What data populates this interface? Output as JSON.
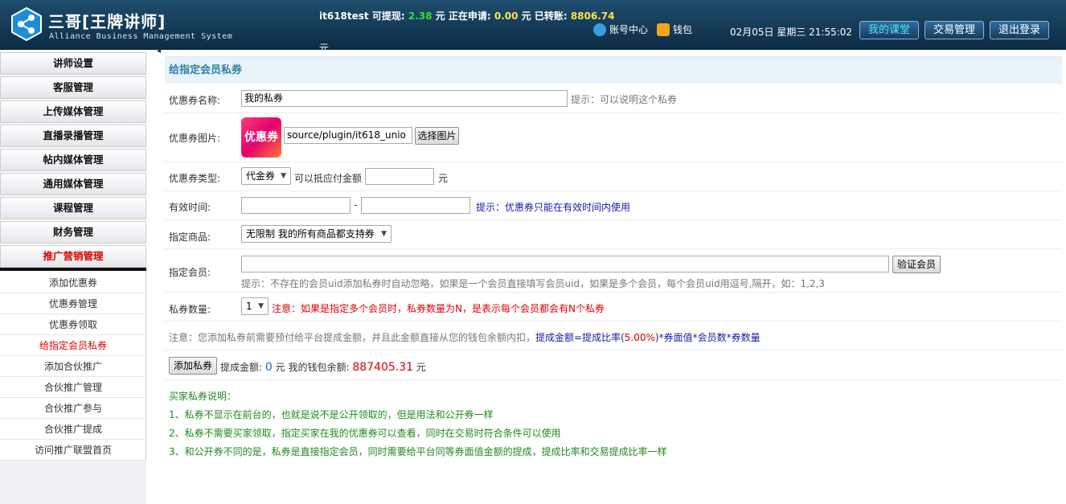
{
  "header": {
    "app_title": "三哥[王牌讲师]",
    "app_subtitle": "Alliance Business Management System",
    "balance": {
      "user": "it618test",
      "withdrawable_label": "可提现:",
      "withdrawable": "2.38",
      "unit": "元",
      "applying_label": "正在申请:",
      "applying": "0.00",
      "transferred_label": "元 已转账:",
      "transferred": "8806.74",
      "unit2": "元"
    },
    "links": {
      "account": "账号中心",
      "wallet": "钱包"
    },
    "datetime": "02月05日 星期三 21:55:02",
    "buttons": {
      "my_classroom": "我的课堂",
      "trade": "交易管理",
      "logout": "退出登录"
    }
  },
  "sidebar": {
    "items": [
      {
        "label": "讲师设置"
      },
      {
        "label": "客服管理"
      },
      {
        "label": "上传媒体管理"
      },
      {
        "label": "直播录播管理"
      },
      {
        "label": "帖内媒体管理"
      },
      {
        "label": "通用媒体管理"
      },
      {
        "label": "课程管理"
      },
      {
        "label": "财务管理"
      },
      {
        "label": "推广营销管理"
      }
    ],
    "sub_items": [
      {
        "label": "添加优惠券"
      },
      {
        "label": "优惠券管理"
      },
      {
        "label": "优惠券领取"
      },
      {
        "label": "给指定会员私券"
      },
      {
        "label": "添加合伙推广"
      },
      {
        "label": "合伙推广管理"
      },
      {
        "label": "合伙推广参与"
      },
      {
        "label": "合伙推广提成"
      },
      {
        "label": "访问推广联盟首页"
      }
    ]
  },
  "form": {
    "title": "给指定会员私券",
    "name": {
      "label": "优惠券名称:",
      "value": "我的私券",
      "hint": "提示：可以说明这个私券"
    },
    "image": {
      "label": "优惠券图片:",
      "badge_text": "优惠券",
      "path": "source/plugin/it618_unio",
      "button": "选择图片"
    },
    "type": {
      "label": "优惠券类型:",
      "selected": "代金券",
      "desc": "可以抵应付金额",
      "value": "",
      "unit": "元"
    },
    "valid_time": {
      "label": "有效时间:",
      "start": "",
      "dash": "-",
      "end": "",
      "hint": "提示：优惠券只能在有效时间内使用"
    },
    "goods": {
      "label": "指定商品:",
      "selected": "无限制 我的所有商品都支持券"
    },
    "members": {
      "label": "指定会员:",
      "value": "",
      "button": "验证会员",
      "hint": "提示：不存在的会员uid添加私券时自动忽略，如果是一个会员直接填写会员uid，如果是多个会员，每个会员uid用逗号,隔开，如：1,2,3"
    },
    "quantity": {
      "label": "私券数量:",
      "selected": "1",
      "note": "注意：如果是指定多个会员时，私券数量为N，是表示每个会员都会有N个私券"
    },
    "notice": {
      "prefix": "注意：您添加私券前需要预付给平台提成金额，并且此金额直接从您的钱包余额内扣，",
      "formula_a": "提成金额=提成比率(",
      "rate": "5.00%",
      "formula_b": ")*券面值*会员数*券数量"
    },
    "submit": {
      "button": "添加私券",
      "commission_label": "提成金额:",
      "commission": "0",
      "unit": "元",
      "wallet_label": "我的钱包余额:",
      "wallet": "887405.31",
      "unit2": "元"
    },
    "explain": {
      "title": "买家私券说明：",
      "lines": [
        "1、私券不显示在前台的，也就是说不是公开领取的，但是用法和公开券一样",
        "2、私券不需要买家领取，指定买家在我的优惠券可以查看，同时在交易时符合条件可以使用",
        "3、和公开券不同的是，私券是直接指定会员，同时需要给平台同等券面值金额的提成，提成比率和交易提成比率一样"
      ]
    }
  },
  "colors": {
    "header_bg": "#0c2b45",
    "accent_blue": "#2c7fa8",
    "red": "#e00000",
    "green": "#1e8a1e"
  }
}
